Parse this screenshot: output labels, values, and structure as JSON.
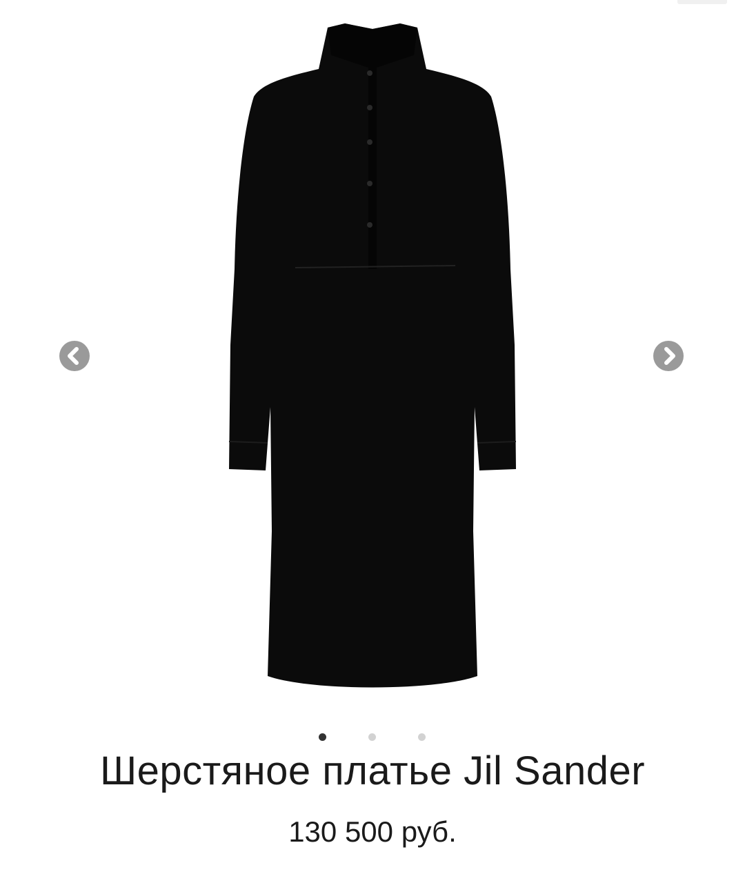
{
  "product": {
    "title": "Шерстяное платье Jil Sander",
    "price": "130 500 руб."
  },
  "gallery": {
    "image_subject": "black wool dress",
    "prev_icon": "chevron-left-icon",
    "next_icon": "chevron-right-icon",
    "slide_count": 3,
    "active_slide": 1
  },
  "colors": {
    "dress": "#0b0b0b",
    "arrow_bg": "#9a9a9a",
    "dot_active": "#333333",
    "dot_inactive": "#d2d2d2",
    "text": "#1a1a1a"
  }
}
